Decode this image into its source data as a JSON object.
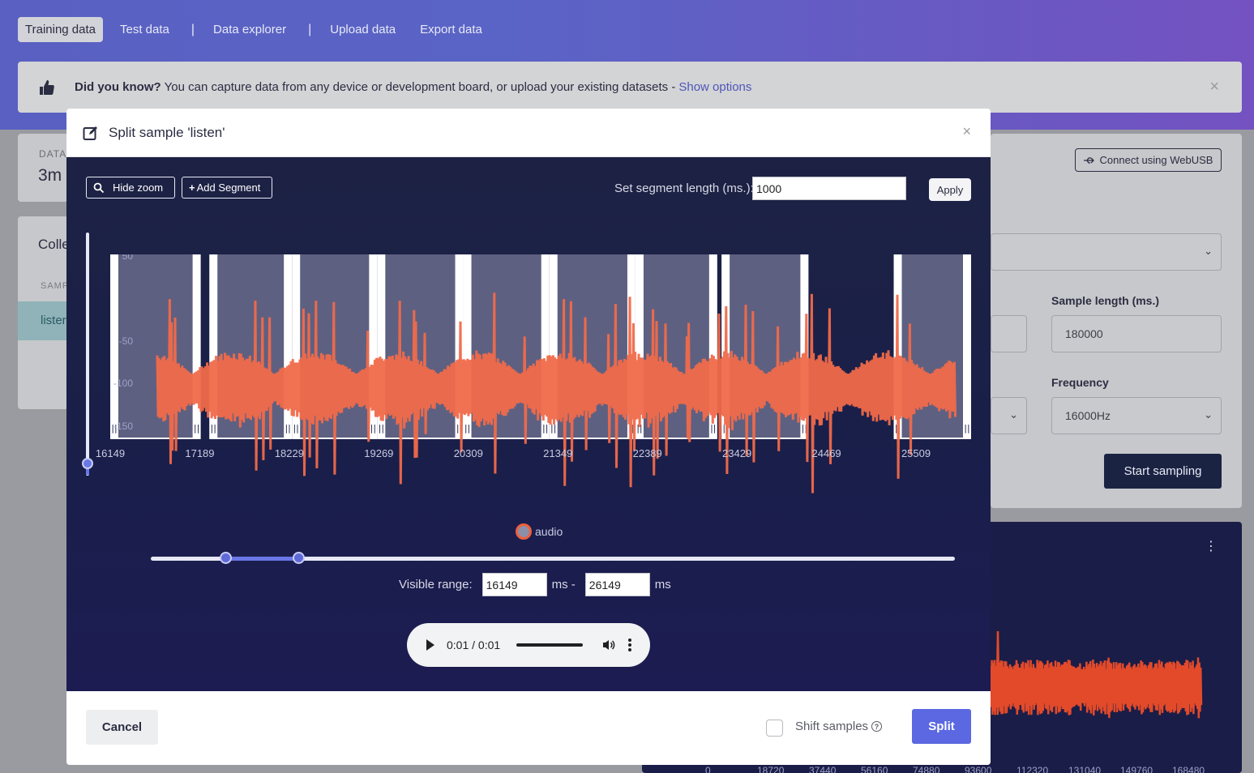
{
  "nav": {
    "tabs": [
      {
        "label": "Training data",
        "active": true
      },
      {
        "label": "Test data",
        "active": false
      },
      {
        "label": "Data explorer",
        "active": false
      },
      {
        "label": "Upload data",
        "active": false
      },
      {
        "label": "Export data",
        "active": false
      }
    ],
    "separator": "|"
  },
  "banner": {
    "bold": "Did you know?",
    "text": "You can capture data from any device or development board, or upload your existing datasets -",
    "link": "Show options",
    "close": "×"
  },
  "background": {
    "stat_label": "DATA",
    "stat_value": "3m",
    "collected_title": "Colle",
    "sample_header": "SAMP",
    "sample_row": "lister",
    "webusb_label": "Connect using WebUSB",
    "sample_length_label": "Sample length (ms.)",
    "sample_length_value": "180000",
    "frequency_label": "Frequency",
    "frequency_value": "16000Hz",
    "start_sampling": "Start sampling",
    "bg_chart_ticks": [
      "0",
      "18720",
      "37440",
      "56160",
      "74880",
      "93600",
      "112320",
      "131040",
      "149760",
      "168480"
    ]
  },
  "modal": {
    "title": "Split sample 'listen'",
    "close": "×",
    "hide_zoom": "Hide zoom",
    "add_segment": "Add Segment",
    "segment_length_label": "Set segment length (ms.):",
    "segment_length_value": "1000",
    "apply": "Apply",
    "legend": "audio",
    "visible_range_label": "Visible range:",
    "visible_from": "16149",
    "visible_to": "26149",
    "ms_dash": "ms -",
    "ms": "ms",
    "player_time": "0:01 / 0:01",
    "cancel": "Cancel",
    "shift_samples": "Shift samples",
    "split": "Split",
    "range_slider": {
      "min": 0,
      "max": 180000,
      "low": 16149,
      "high": 26149
    }
  },
  "chart_data": {
    "type": "line",
    "series": [
      {
        "name": "audio",
        "color": "#ef5f3c"
      }
    ],
    "x_ticks": [
      "16149",
      "17189",
      "18229",
      "19269",
      "20309",
      "21349",
      "22389",
      "23429",
      "24469",
      "25509"
    ],
    "y_ticks": [
      "100",
      "50",
      "-50",
      "-100",
      "-150"
    ],
    "xlim": [
      16149,
      26149
    ],
    "segments": [
      [
        16149,
        17200
      ],
      [
        17300,
        18260
      ],
      [
        18260,
        19250
      ],
      [
        19250,
        20250
      ],
      [
        20250,
        21250
      ],
      [
        21250,
        22250
      ],
      [
        22250,
        23200
      ],
      [
        23250,
        24260
      ],
      [
        25250,
        26149
      ]
    ],
    "accent": "#ef5f3c",
    "segment_fill": "#5e6081"
  }
}
